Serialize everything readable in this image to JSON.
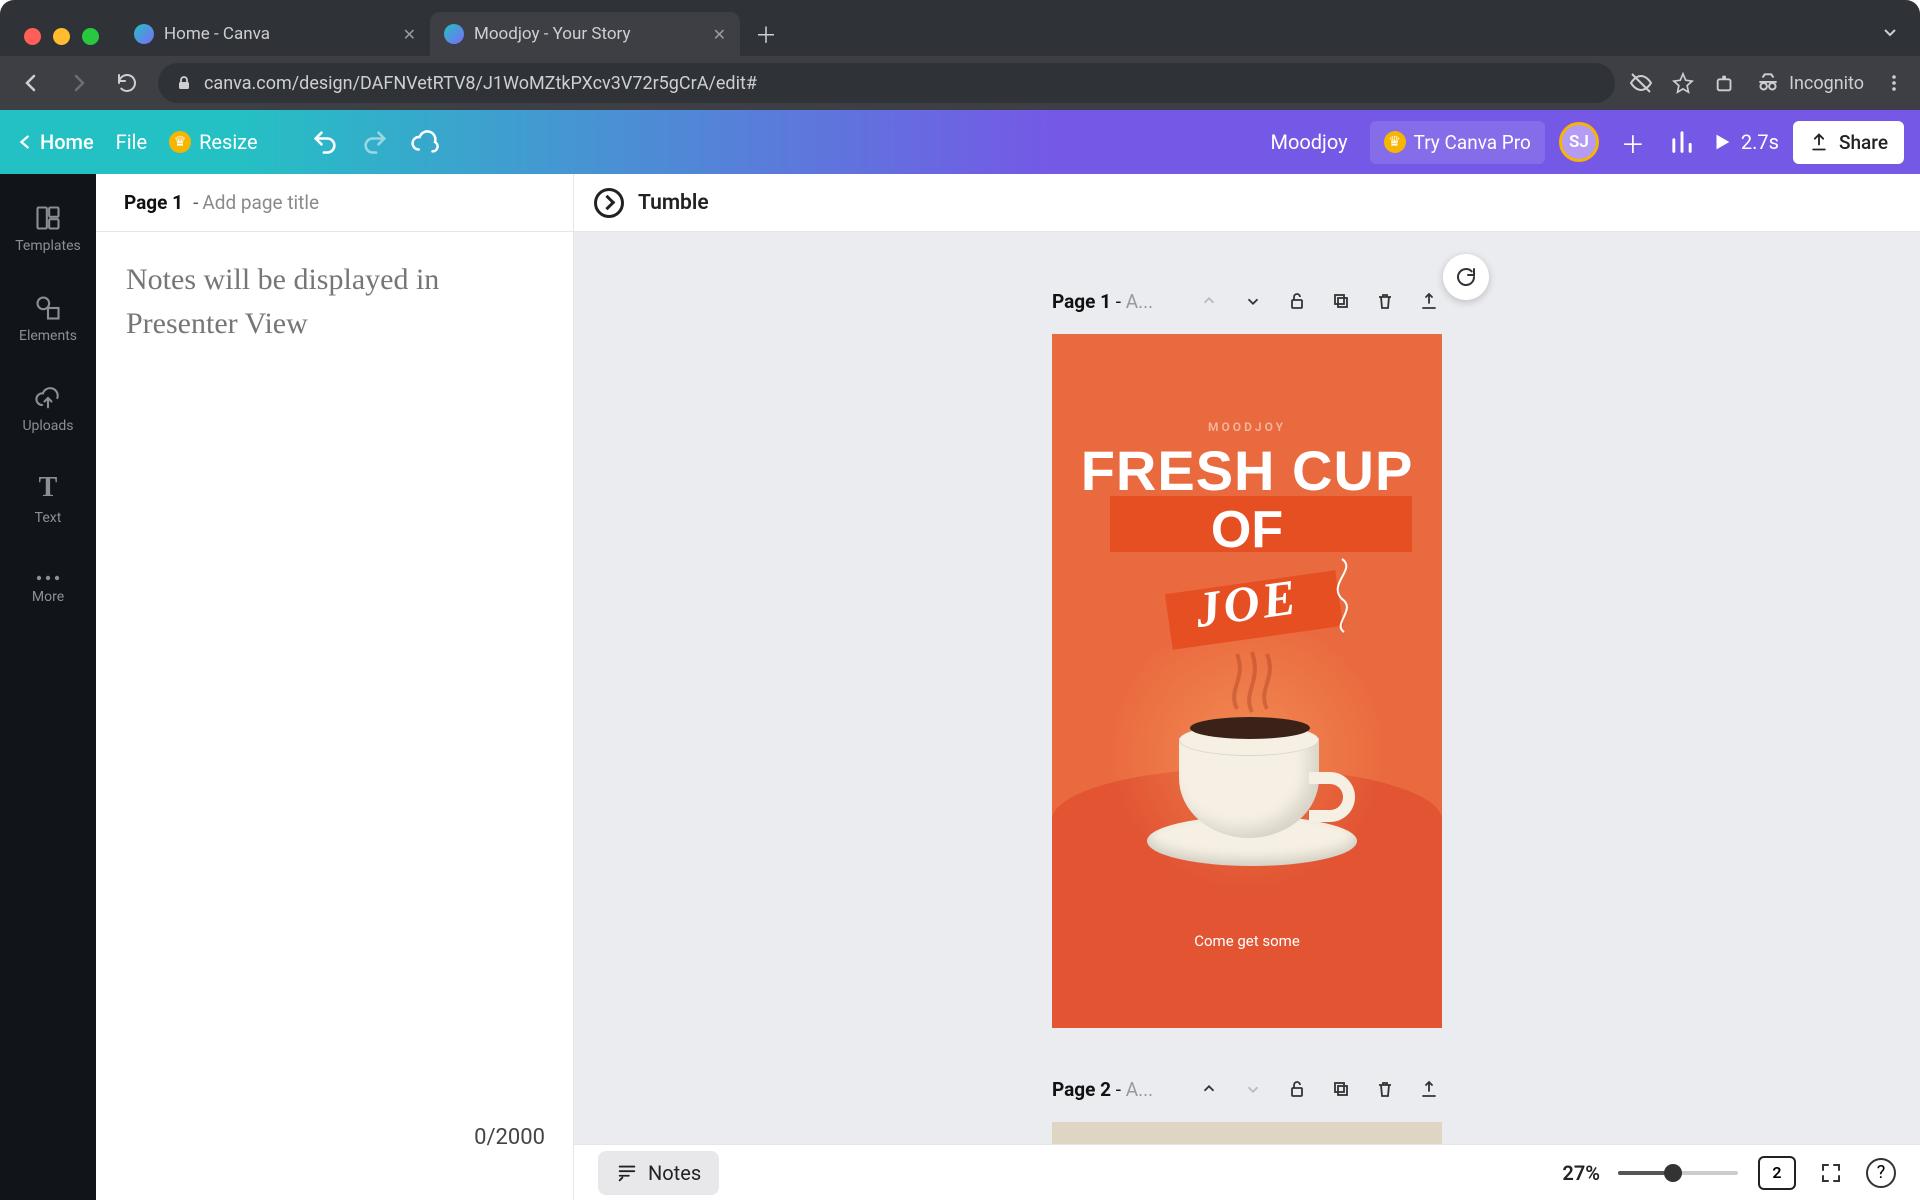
{
  "browser": {
    "tabs": [
      {
        "title": "Home - Canva",
        "active": false
      },
      {
        "title": "Moodjoy - Your Story",
        "active": true
      }
    ],
    "url": "canva.com/design/DAFNVetRTV8/J1WoMZtkPXcv3V72r5gCrA/edit#",
    "incognito_label": "Incognito"
  },
  "header": {
    "home": "Home",
    "file": "File",
    "resize": "Resize",
    "doc_name": "Moodjoy",
    "try_pro": "Try Canva Pro",
    "avatar_initials": "SJ",
    "play_time": "2.7s",
    "share": "Share"
  },
  "rail": {
    "items": [
      {
        "icon": "templates",
        "label": "Templates"
      },
      {
        "icon": "elements",
        "label": "Elements"
      },
      {
        "icon": "uploads",
        "label": "Uploads"
      },
      {
        "icon": "text",
        "label": "Text"
      },
      {
        "icon": "more",
        "label": "More"
      }
    ]
  },
  "notes": {
    "page_label": "Page 1",
    "title_placeholder": "Add page title",
    "body_placeholder": "Notes will be displayed in Presenter View",
    "counter": "0/2000"
  },
  "transition": {
    "name": "Tumble"
  },
  "pages": [
    {
      "label": "Page 1",
      "subtitle_abbrev": "A...",
      "content": {
        "brand": "MOODJOY",
        "line1": "FRESH CUP",
        "line2": "OF",
        "line3": "JOE",
        "tagline": "Come get some"
      }
    },
    {
      "label": "Page 2",
      "subtitle_abbrev": "A..."
    }
  ],
  "bottom": {
    "notes_btn": "Notes",
    "zoom_pct": "27%",
    "page_count": "2"
  },
  "colors": {
    "accent_teal": "#24c1c4",
    "accent_purple": "#7558e6",
    "story_bg": "#ea6a3f",
    "story_bar": "#e54f22"
  }
}
